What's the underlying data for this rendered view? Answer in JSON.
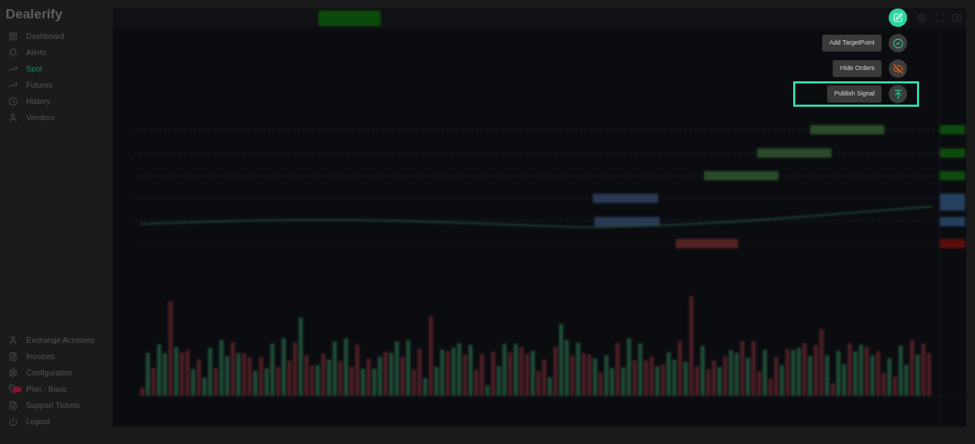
{
  "brand": {
    "name": "Dealerify"
  },
  "sidebar": {
    "top_items": [
      {
        "label": "Dashboard",
        "selected": false
      },
      {
        "label": "Alerts",
        "selected": false
      },
      {
        "label": "Spot",
        "selected": true
      },
      {
        "label": "Futures",
        "selected": false
      },
      {
        "label": "History",
        "selected": false
      },
      {
        "label": "Vendors",
        "selected": false
      }
    ],
    "bottom_items": [
      {
        "label": "Exchange Accounts",
        "badge": false
      },
      {
        "label": "Invoices",
        "badge": false
      },
      {
        "label": "Configuration",
        "badge": false
      },
      {
        "label": "Plan : Basic",
        "badge": true
      },
      {
        "label": "Support Tickets",
        "badge": false
      },
      {
        "label": "Logout",
        "badge": false
      }
    ]
  },
  "action_menu": {
    "items": [
      {
        "kind": "target",
        "label": "Add TargetPoint",
        "highlighted": false
      },
      {
        "kind": "hide",
        "label": "Hide Orders",
        "highlighted": false
      },
      {
        "kind": "publish",
        "label": "Publish Signal",
        "highlighted": true
      }
    ]
  }
}
